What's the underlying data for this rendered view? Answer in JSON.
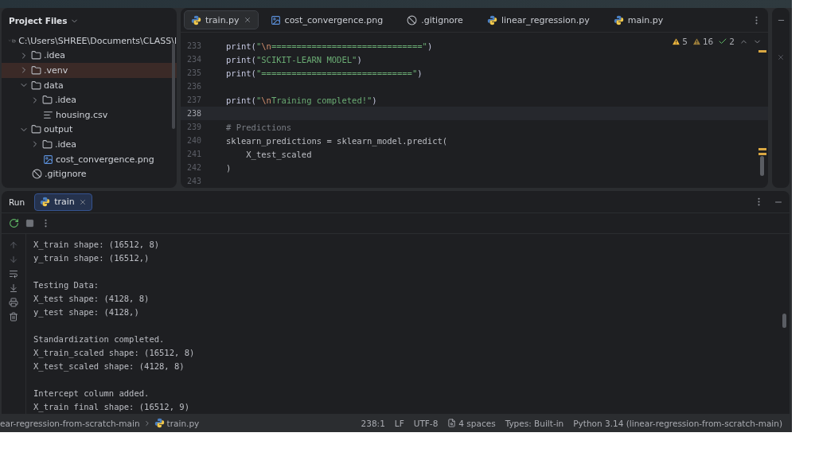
{
  "project": {
    "title": "Project Files",
    "tree": [
      {
        "label": "C:\\Users\\SHREE\\Documents\\CLASS\\l",
        "kind": "root",
        "expanded": true,
        "selected": false,
        "children": [
          {
            "label": ".idea",
            "kind": "folder",
            "expanded": false,
            "selected": false
          },
          {
            "label": ".venv",
            "kind": "folder",
            "expanded": false,
            "selected": true
          },
          {
            "label": "data",
            "kind": "folder",
            "expanded": true,
            "selected": false,
            "children": [
              {
                "label": ".idea",
                "kind": "folder",
                "expanded": false,
                "selected": false
              },
              {
                "label": "housing.csv",
                "kind": "text",
                "selected": false
              }
            ]
          },
          {
            "label": "output",
            "kind": "folder",
            "expanded": true,
            "selected": false,
            "children": [
              {
                "label": ".idea",
                "kind": "folder",
                "expanded": false,
                "selected": false
              },
              {
                "label": "cost_convergence.png",
                "kind": "image",
                "selected": false
              }
            ]
          },
          {
            "label": ".gitignore",
            "kind": "ignore",
            "selected": false
          }
        ]
      }
    ]
  },
  "editor": {
    "tabs": [
      {
        "label": "train.py",
        "kind": "python",
        "selected": true
      },
      {
        "label": "cost_convergence.png",
        "kind": "image",
        "selected": false
      },
      {
        "label": ".gitignore",
        "kind": "ignore",
        "selected": false
      },
      {
        "label": "linear_regression.py",
        "kind": "python",
        "selected": false
      },
      {
        "label": "main.py",
        "kind": "python",
        "selected": false
      }
    ],
    "inspections": [
      {
        "kind": "error",
        "count": "5"
      },
      {
        "kind": "warning",
        "count": "16"
      },
      {
        "kind": "ok",
        "count": "2"
      }
    ],
    "lines": [
      {
        "number": "233",
        "current": false,
        "tokens": [
          {
            "kind": "fn",
            "text": "print("
          },
          {
            "kind": "str",
            "text": "\""
          },
          {
            "kind": "esc",
            "text": "\\n"
          },
          {
            "kind": "str",
            "text": "==============================\""
          },
          {
            "kind": "fn",
            "text": ")"
          }
        ]
      },
      {
        "number": "234",
        "current": false,
        "tokens": [
          {
            "kind": "fn",
            "text": "print("
          },
          {
            "kind": "str",
            "text": "\"SCIKIT-LEARN MODEL\""
          },
          {
            "kind": "fn",
            "text": ")"
          }
        ]
      },
      {
        "number": "235",
        "current": false,
        "tokens": [
          {
            "kind": "fn",
            "text": "print("
          },
          {
            "kind": "str",
            "text": "\"==============================\""
          },
          {
            "kind": "fn",
            "text": ")"
          }
        ]
      },
      {
        "number": "236",
        "current": false
      },
      {
        "number": "237",
        "current": false,
        "tokens": [
          {
            "kind": "fn",
            "text": "print("
          },
          {
            "kind": "str",
            "text": "\""
          },
          {
            "kind": "esc",
            "text": "\\n"
          },
          {
            "kind": "str",
            "text": "Training completed!\""
          },
          {
            "kind": "fn",
            "text": ")"
          }
        ]
      },
      {
        "number": "238",
        "current": true
      },
      {
        "number": "239",
        "current": false,
        "tokens": [
          {
            "kind": "comment",
            "text": "# Predictions"
          }
        ]
      },
      {
        "number": "240",
        "current": false,
        "tokens": [
          {
            "kind": "plain",
            "text": "sklearn_predictions = sklearn_model.predict("
          }
        ]
      },
      {
        "number": "241",
        "current": false,
        "tokens": [
          {
            "kind": "plain",
            "text": "    X_test_scaled"
          }
        ]
      },
      {
        "number": "242",
        "current": false,
        "tokens": [
          {
            "kind": "plain",
            "text": ")"
          }
        ]
      },
      {
        "number": "243",
        "current": false
      }
    ]
  },
  "run": {
    "title": "Run",
    "tabs": [
      {
        "label": "train",
        "selected": true
      }
    ],
    "output": [
      [
        "X_train shape: (16512, 8)",
        "y_train shape: (16512,)"
      ],
      [
        "Testing Data:",
        "X_test shape: (4128, 8)",
        "y_test shape: (4128,)"
      ],
      [
        "Standardization completed.",
        "X_train_scaled shape: (16512, 8)",
        "X_test_scaled shape: (4128, 8)"
      ],
      [
        "Intercept column added.",
        "X_train final shape: (16512, 9)"
      ]
    ]
  },
  "status_bar": {
    "breadcrumb": [
      "ear-regression-from-scratch-main",
      "train.py"
    ],
    "items": [
      "238:1",
      "LF",
      "UTF-8",
      "4 spaces",
      "Types: Built-in",
      "Python 3.14 (linear-regression-from-scratch-main)"
    ]
  }
}
